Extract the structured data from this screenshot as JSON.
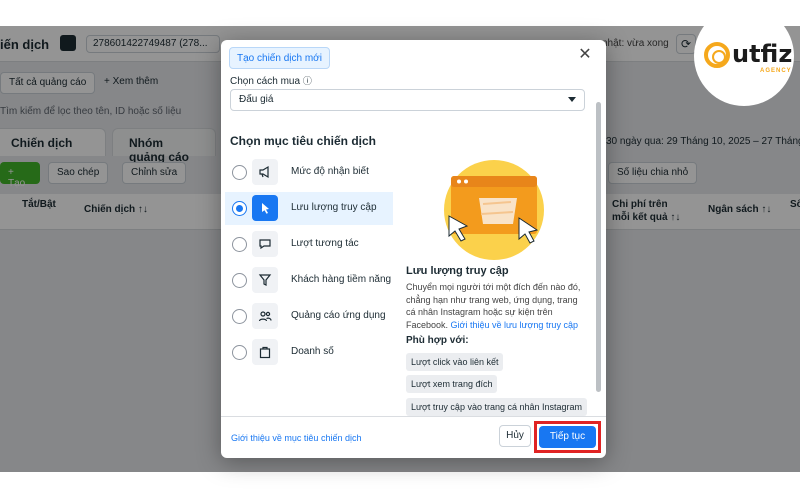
{
  "background": {
    "topbar": {
      "title": "iến dịch",
      "account": "278601422749487 (278...",
      "update": "nhật: vừa xong"
    },
    "toolbar": {
      "all_ads": "Tất cả quảng cáo",
      "view_more": "+ Xem thêm"
    },
    "search_hint": "Tìm kiếm để lọc theo tên, ID hoặc số liệu",
    "tabs": [
      "Chiến dịch",
      "Nhóm quảng cáo"
    ],
    "date_range": "30 ngày qua: 29 Tháng 10, 2025 – 27 Tháng 11, 2",
    "actions": {
      "create": "+ Tạo",
      "duplicate": "Sao chép",
      "edit": "Chỉnh sửa",
      "breakdown": "Số liệu chia nhỏ"
    },
    "columns": [
      "Tắt/Bật",
      "Chiến dịch ↑↓",
      "Chi phí trên mỗi kết quả ↑↓",
      "Ngân sách ↑↓",
      "Số"
    ]
  },
  "modal": {
    "tab_label": "Tạo chiến dịch mới",
    "buy_label": "Chọn cách mua",
    "buy_value": "Đấu giá",
    "section_title": "Chọn mục tiêu chiến dịch",
    "objectives": [
      {
        "label": "Mức độ nhận biết",
        "icon": "megaphone-icon",
        "selected": false
      },
      {
        "label": "Lưu lượng truy cập",
        "icon": "cursor-icon",
        "selected": true
      },
      {
        "label": "Lượt tương tác",
        "icon": "chat-bubble-icon",
        "selected": false
      },
      {
        "label": "Khách hàng tiềm năng",
        "icon": "filter-icon",
        "selected": false
      },
      {
        "label": "Quảng cáo ứng dụng",
        "icon": "people-icon",
        "selected": false
      },
      {
        "label": "Doanh số",
        "icon": "shopping-bag-icon",
        "selected": false
      }
    ],
    "detail": {
      "title": "Lưu lượng truy cập",
      "description": "Chuyển mọi người tới một đích đến nào đó, chẳng hạn như trang web, ứng dụng, trang cá nhân Instagram hoặc sự kiện trên Facebook.",
      "link": "Giới thiệu về lưu lượng truy cập",
      "fit_title": "Phù hợp với:",
      "fits": [
        "Lượt click vào liên kết",
        "Lượt xem trang đích",
        "Lượt truy cập vào trang cá nhân Instagram"
      ]
    },
    "footer": {
      "link": "Giới thiệu về mục tiêu chiến dịch",
      "cancel": "Hủy",
      "continue": "Tiếp tục"
    }
  },
  "logo": {
    "text": "utfiz",
    "sub": "AGENCY"
  },
  "colors": {
    "accent": "#1877f2",
    "highlight_outline": "#e02323",
    "logo_orange": "#f5a81c"
  }
}
